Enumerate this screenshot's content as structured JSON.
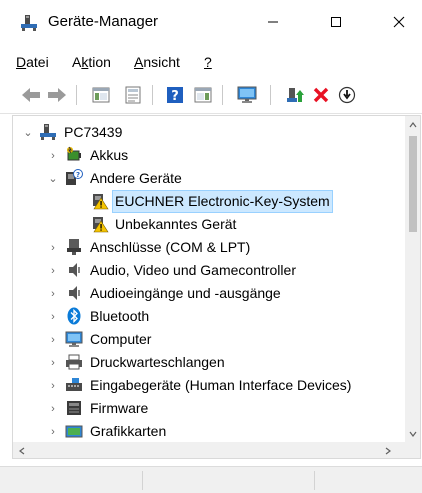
{
  "window": {
    "title": "Geräte-Manager",
    "controls": {
      "minimize": "minimize-icon",
      "maximize": "maximize-icon",
      "close": "close-icon"
    }
  },
  "menu": {
    "items": [
      {
        "label": "Datei",
        "mnemonic": "D"
      },
      {
        "label": "Aktion",
        "mnemonic": "k"
      },
      {
        "label": "Ansicht",
        "mnemonic": "A"
      },
      {
        "label": "?",
        "mnemonic": "?"
      }
    ]
  },
  "toolbar": {
    "buttons": [
      "back-icon",
      "forward-icon",
      "console-tree-icon",
      "properties-icon",
      "help-icon",
      "action-pane-icon",
      "monitor-scan-icon",
      "update-driver-icon",
      "uninstall-device-icon",
      "disable-device-icon"
    ]
  },
  "tree": {
    "root": "PC73439",
    "nodes": [
      {
        "label": "Akkus",
        "icon": "battery-icon",
        "expanded": false
      },
      {
        "label": "Andere Geräte",
        "icon": "unknown-device-icon",
        "expanded": true,
        "children": [
          {
            "label": "EUCHNER Electronic-Key-System",
            "icon": "warning-device-icon",
            "selected": true
          },
          {
            "label": "Unbekanntes Gerät",
            "icon": "warning-device-icon",
            "selected": false
          }
        ]
      },
      {
        "label": "Anschlüsse (COM & LPT)",
        "icon": "port-icon",
        "expanded": false
      },
      {
        "label": "Audio, Video und Gamecontroller",
        "icon": "speaker-icon",
        "expanded": false
      },
      {
        "label": "Audioeingänge und -ausgänge",
        "icon": "speaker-icon",
        "expanded": false
      },
      {
        "label": "Bluetooth",
        "icon": "bluetooth-icon",
        "expanded": false
      },
      {
        "label": "Computer",
        "icon": "computer-icon",
        "expanded": false
      },
      {
        "label": "Druckwarteschlangen",
        "icon": "printer-icon",
        "expanded": false
      },
      {
        "label": "Eingabegeräte (Human Interface Devices)",
        "icon": "hid-icon",
        "expanded": false
      },
      {
        "label": "Firmware",
        "icon": "firmware-icon",
        "expanded": false
      },
      {
        "label": "Grafikkarten",
        "icon": "display-adapter-icon",
        "expanded": false
      }
    ]
  },
  "colors": {
    "selection": "#cce8ff",
    "selection_border": "#99d1ff",
    "warning": "#f5c400",
    "uninstall_red": "#e81123",
    "help_blue": "#1f5fbf",
    "bluetooth_blue": "#0a7bd8"
  }
}
